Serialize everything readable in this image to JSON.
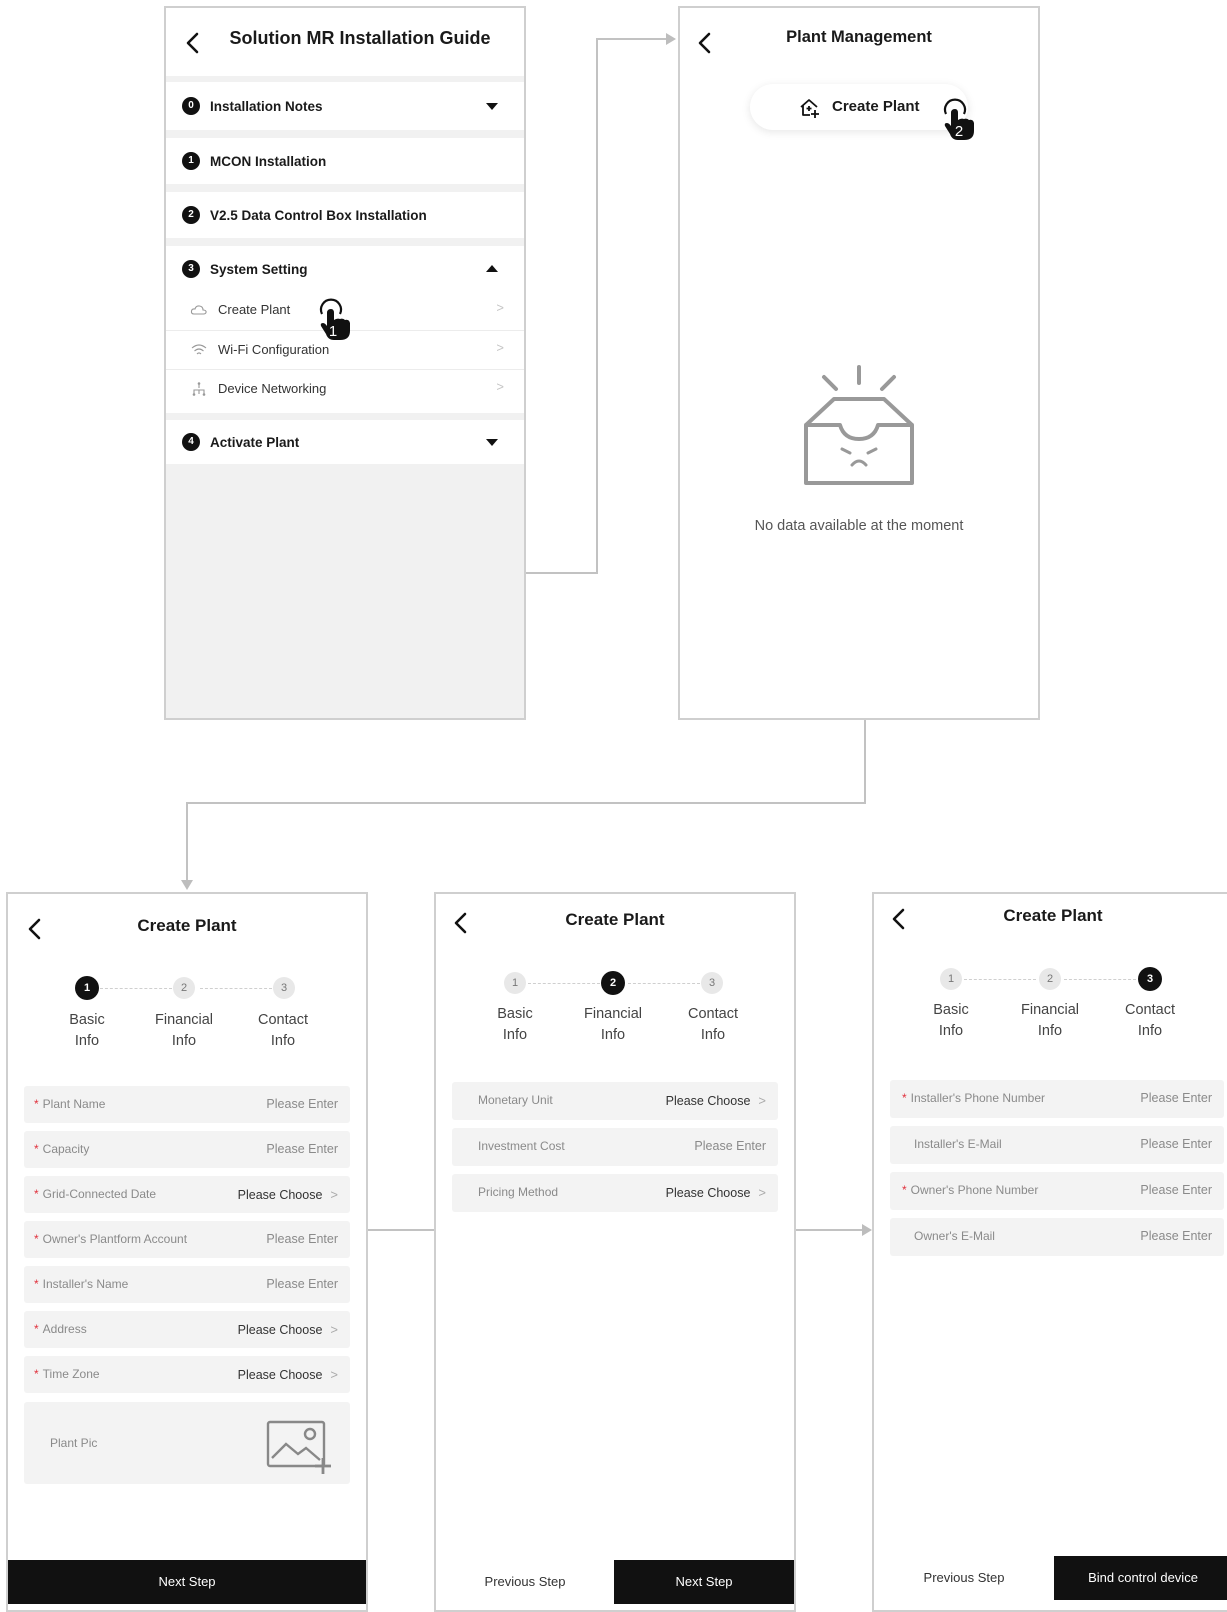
{
  "guide": {
    "title": "Solution MR Installation Guide",
    "sections": [
      {
        "number": "0",
        "label": "Installation Notes"
      },
      {
        "number": "1",
        "label": "MCON Installation"
      },
      {
        "number": "2",
        "label": "V2.5  Data Control Box Installation"
      },
      {
        "number": "3",
        "label": "System Setting"
      },
      {
        "number": "4",
        "label": "Activate Plant"
      }
    ],
    "sub_items": [
      {
        "label": "Create Plant",
        "icon": "cloud-icon"
      },
      {
        "label": "Wi-Fi Configuration",
        "icon": "wifi-icon"
      },
      {
        "label": "Device Networking",
        "icon": "network-icon"
      }
    ],
    "chevron": ">",
    "tap_marker": "1"
  },
  "plant_mgmt": {
    "title": "Plant Management",
    "create_button": "Create Plant",
    "empty_text": "No data available at the moment",
    "tap_marker": "2"
  },
  "create_plant": {
    "title": "Create Plant",
    "steps": [
      {
        "number": "1",
        "label_line1": "Basic",
        "label_line2": "Info"
      },
      {
        "number": "2",
        "label_line1": "Financial",
        "label_line2": "Info"
      },
      {
        "number": "3",
        "label_line1": "Contact",
        "label_line2": "Info"
      }
    ],
    "required_mark": "*",
    "chevron": ">",
    "basic_fields": [
      {
        "label": "Plant Name",
        "value": "Please Enter"
      },
      {
        "label": "Capacity",
        "value": "Please Enter"
      },
      {
        "label": "Grid-Connected Date",
        "value": "Please Choose"
      },
      {
        "label": "Owner's Plantform Account",
        "value": "Please Enter"
      },
      {
        "label": "Installer's Name",
        "value": "Please Enter"
      },
      {
        "label": "Address",
        "value": "Please Choose"
      },
      {
        "label": "Time Zone",
        "value": "Please Choose"
      }
    ],
    "plant_pic_label": "Plant Pic",
    "financial_fields": [
      {
        "label": "Monetary Unit",
        "value": "Please Choose"
      },
      {
        "label": "Investment Cost",
        "value": "Please Enter"
      },
      {
        "label": "Pricing Method",
        "value": "Please Choose"
      }
    ],
    "contact_fields": [
      {
        "label": "Installer's Phone Number",
        "value": "Please Enter"
      },
      {
        "label": "Installer's E-Mail",
        "value": "Please Enter"
      },
      {
        "label": "Owner's Phone Number",
        "value": "Please Enter"
      },
      {
        "label": "Owner's E-Mail",
        "value": "Please Enter"
      }
    ],
    "next_step": "Next Step",
    "previous_step": "Previous Step",
    "bind_device": "Bind control device"
  }
}
